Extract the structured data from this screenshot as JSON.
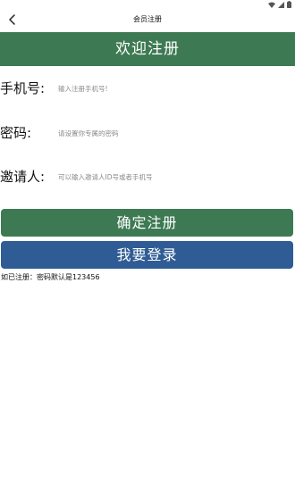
{
  "status_bar": {
    "icons": [
      "wifi-icon",
      "signal-icon",
      "battery-icon"
    ]
  },
  "nav": {
    "back_icon": "chevron-left-icon",
    "title": "会员注册"
  },
  "banner": {
    "title": "欢迎注册"
  },
  "form": {
    "phone": {
      "label": "手机号:",
      "placeholder": "输入注册手机号!"
    },
    "password": {
      "label": "密码:",
      "placeholder": "请设置你专属的密码"
    },
    "inviter": {
      "label": "邀请人:",
      "placeholder": "可以输入邀请人ID号或者手机号"
    }
  },
  "buttons": {
    "register_label": "确定注册",
    "login_label": "我要登录"
  },
  "hint": "如已注册：密码默认是123456",
  "colors": {
    "primary_green": "#3d7a53",
    "login_blue": "#2f5c94"
  }
}
